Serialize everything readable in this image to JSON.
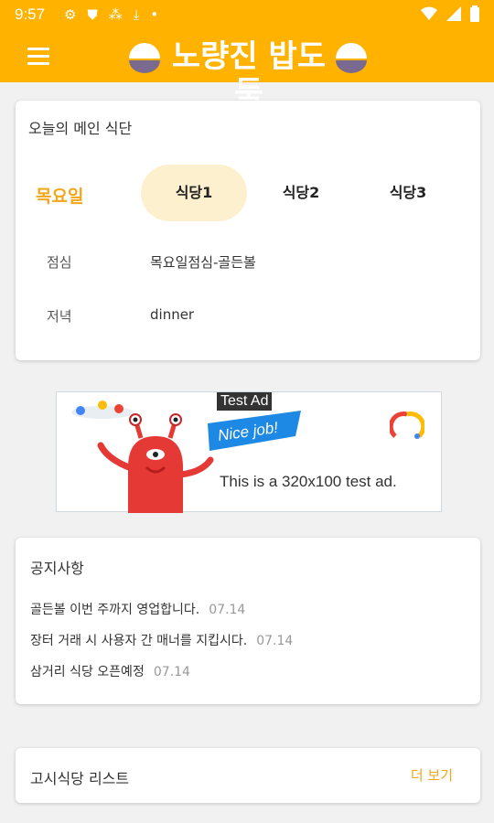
{
  "status": {
    "time": "9:57"
  },
  "app": {
    "title": "노량진 밥도둑"
  },
  "menu": {
    "title": "오늘의 메인 식단",
    "day": "목요일",
    "tabs": [
      "식당1",
      "식당2",
      "식당3"
    ],
    "meals": [
      {
        "label": "점심",
        "value": "목요일점심-골든볼"
      },
      {
        "label": "저녁",
        "value": "dinner"
      }
    ]
  },
  "ad": {
    "badge": "Test Ad",
    "banner": "Nice job!",
    "text": "This is a 320x100 test ad."
  },
  "notices": {
    "title": "공지사항",
    "items": [
      {
        "text": "골든볼 이번 주까지 영업합니다.",
        "date": "07.14"
      },
      {
        "text": "장터 거래 시 사용자 간 매너를 지킵시다.",
        "date": "07.14"
      },
      {
        "text": "삼거리 식당 오픈예정",
        "date": "07.14"
      }
    ]
  },
  "restaurants": {
    "title": "고시식당 리스트",
    "more": "더 보기"
  },
  "colors": {
    "primary": "#ffb300",
    "accent": "#f2a71b",
    "tab_active": "#fdf0cf"
  }
}
